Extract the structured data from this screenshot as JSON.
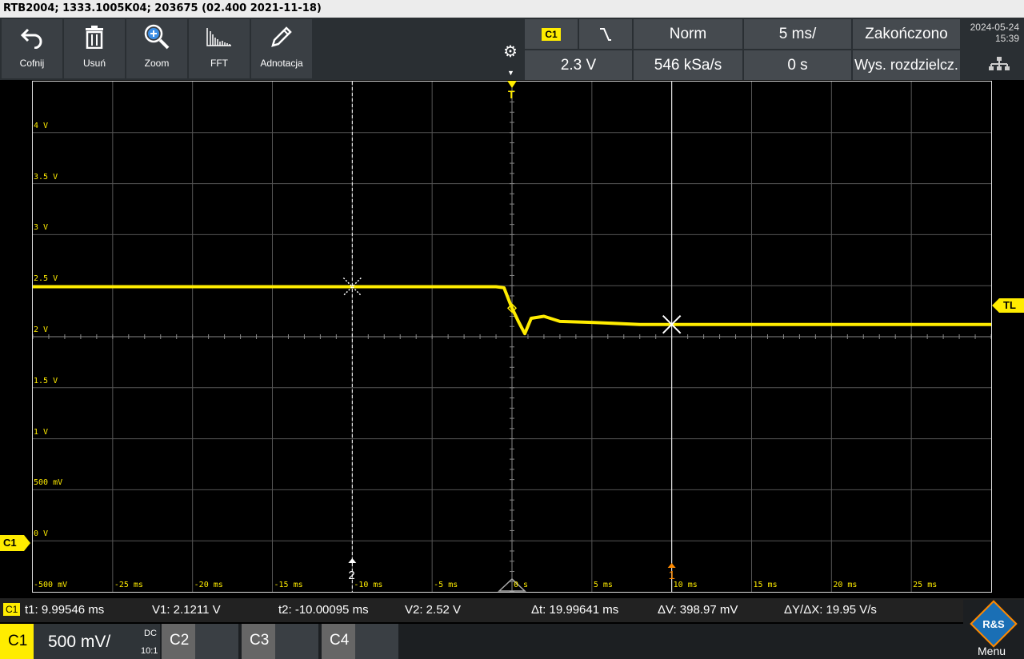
{
  "title": "RTB2004; 1333.1005K04; 203675 (02.400 2021-11-18)",
  "toolbar": {
    "undo": "Cofnij",
    "delete": "Usuń",
    "zoom": "Zoom",
    "fft": "FFT",
    "annotate": "Adnotacja"
  },
  "trigger": {
    "channel": "C1",
    "mode": "Norm",
    "timebase": "5 ms/",
    "status": "Zakończono",
    "level": "2.3 V",
    "sample_rate": "546 kSa/s",
    "position": "0 s",
    "acq_mode": "Wys. rozdzielcz."
  },
  "datetime": {
    "date": "2024-05-24",
    "time": "15:39"
  },
  "markers": {
    "trigger_top": "T",
    "trigger_level": "TL",
    "channel_marker": "C1",
    "cursor1": "1",
    "cursor2": "2"
  },
  "axis": {
    "y_labels": [
      "4 V",
      "3.5 V",
      "3 V",
      "2.5 V",
      "2 V",
      "1.5 V",
      "1 V",
      "500 mV",
      "0 V",
      "-500 mV"
    ],
    "x_labels": [
      "-25 ms",
      "-20 ms",
      "-15 ms",
      "-10 ms",
      "-5 ms",
      "0 s",
      "5 ms",
      "10 ms",
      "15 ms",
      "20 ms",
      "25 ms"
    ]
  },
  "chart_data": {
    "type": "line",
    "title": "",
    "xlabel": "",
    "ylabel": "",
    "xlim": [
      -30,
      30
    ],
    "ylim": [
      -0.5,
      4.5
    ],
    "x_unit": "ms",
    "y_unit": "V",
    "grid": true,
    "series": [
      {
        "x": [
          -30,
          -25,
          -20,
          -15,
          -10,
          -5,
          -1,
          -0.5,
          0,
          0.4,
          0.8,
          1.2,
          2.0,
          3.0,
          5.0,
          8.0,
          10.0,
          15.0,
          20.0,
          25.0,
          30.0
        ],
        "values": [
          2.49,
          2.49,
          2.49,
          2.49,
          2.49,
          2.49,
          2.49,
          2.48,
          2.28,
          2.15,
          2.03,
          2.18,
          2.2,
          2.15,
          2.14,
          2.12,
          2.12,
          2.12,
          2.12,
          2.12,
          2.12
        ],
        "color": "#ffec00"
      }
    ]
  },
  "measurements": {
    "channel": "C1",
    "t1": "t1: 9.99546 ms",
    "v1": "V1: 2.1211 V",
    "t2": "t2: -10.00095 ms",
    "v2": "V2: 2.52 V",
    "dt": "Δt: 19.99641 ms",
    "dv": "ΔV: 398.97 mV",
    "dydx": "ΔY/ΔX: 19.95 V/s"
  },
  "channels": {
    "c1_name": "C1",
    "c1_scale": "500 mV/",
    "c1_coupling": "DC",
    "c1_probe": "10:1",
    "c2_name": "C2",
    "c3_name": "C3",
    "c4_name": "C4"
  },
  "menu": {
    "logo": "R&S",
    "label": "Menu"
  },
  "colors": {
    "trace": "#ffec00",
    "cursor": "#ffffff",
    "cursor1_marker": "#ff8a00"
  }
}
